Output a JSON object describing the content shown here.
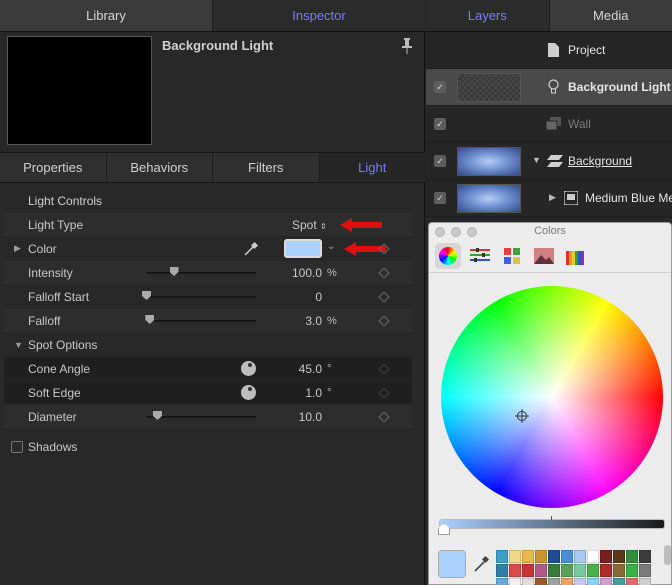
{
  "left_tabs": [
    "Library",
    "Inspector"
  ],
  "right_tabs": [
    "Layers",
    "Media"
  ],
  "object_title": "Background Light",
  "sub_tabs": [
    "Properties",
    "Behaviors",
    "Filters",
    "Light"
  ],
  "light_controls": {
    "header": "Light Controls",
    "light_type": {
      "label": "Light Type",
      "value": "Spot"
    },
    "color": {
      "label": "Color",
      "swatch": "#aad1ff"
    },
    "intensity": {
      "label": "Intensity",
      "value": "100.0",
      "unit": "%",
      "slider_fraction": 0.25
    },
    "falloff_start": {
      "label": "Falloff Start",
      "value": "0",
      "slider_fraction": 0.0
    },
    "falloff": {
      "label": "Falloff",
      "value": "3.0",
      "unit": "%",
      "slider_fraction": 0.03
    },
    "spot_options": {
      "label": "Spot Options"
    },
    "cone_angle": {
      "label": "Cone Angle",
      "value": "45.0",
      "unit": "°"
    },
    "soft_edge": {
      "label": "Soft Edge",
      "value": "1.0",
      "unit": "°"
    },
    "diameter": {
      "label": "Diameter",
      "value": "10.0",
      "slider_fraction": 0.1
    },
    "shadows": {
      "label": "Shadows",
      "checked": false
    }
  },
  "layers": [
    {
      "name": "Project",
      "icon": "document-icon",
      "checked": null,
      "selected": false
    },
    {
      "name": "Background Light",
      "icon": "lightbulb-icon",
      "checked": true,
      "selected": true
    },
    {
      "name": "Wall",
      "icon": "group-icon",
      "checked": true,
      "selected": false
    },
    {
      "name": "Background",
      "icon": "layer-group-icon",
      "checked": true,
      "selected": false
    },
    {
      "name": "Medium Blue Me",
      "icon": "clip-icon",
      "checked": true,
      "selected": false
    }
  ],
  "colors_panel": {
    "title": "Colors",
    "current_color": "#aad1ff",
    "palette": [
      "#3aa0c8",
      "#f1d78a",
      "#e8b84a",
      "#c9952f",
      "#1d4f91",
      "#4a8fd6",
      "#a7c8f0",
      "#ffffff",
      "#7a1f1f",
      "#5a3a1a",
      "#2f8f3a",
      "#3b3b3b",
      "#2f7fa8",
      "#d84a4a",
      "#c93232",
      "#b05a8a",
      "#3a7a3a",
      "#5aa05a",
      "#78c8a0",
      "#4ab04a",
      "#b02a2a",
      "#8a6a3a",
      "#3ab04a",
      "#7a7a7a",
      "#6aa8d8",
      "#f0f0f0",
      "#e0e0e0",
      "#9a5a2a",
      "#a0a0a0",
      "#f0a060",
      "#c8c8f0",
      "#8ad0f0",
      "#d0a0d0",
      "#40a0a0",
      "#e06a6a",
      "#cfcfcf"
    ]
  },
  "accent_color": "#7b7bff",
  "arrow_color": "#e01010"
}
